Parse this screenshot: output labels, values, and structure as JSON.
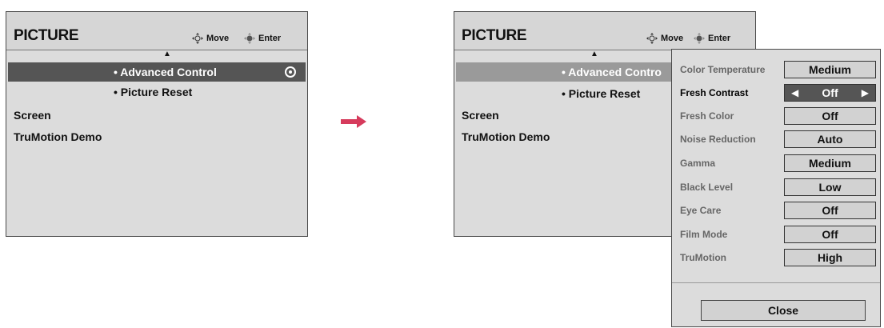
{
  "left_menu": {
    "title": "PICTURE",
    "nav_move": "Move",
    "nav_enter": "Enter",
    "up_arrow": "▲",
    "items": [
      {
        "label": "• Advanced Control",
        "selected": true
      },
      {
        "label": "• Picture Reset",
        "selected": false
      },
      {
        "label": "Screen",
        "selected": false
      },
      {
        "label": "TruMotion Demo",
        "selected": false
      }
    ]
  },
  "right_menu": {
    "title": "PICTURE",
    "nav_move": "Move",
    "nav_enter": "Enter",
    "up_arrow": "▲",
    "items": [
      {
        "label": "• Advanced Contro",
        "selected": true
      },
      {
        "label": "• Picture Reset",
        "selected": false
      },
      {
        "label": "Screen",
        "selected": false
      },
      {
        "label": "TruMotion Demo",
        "selected": false
      }
    ]
  },
  "advanced_control": {
    "options": [
      {
        "label": "Color Temperature",
        "value": "Medium",
        "active": false
      },
      {
        "label": "Fresh Contrast",
        "value": "Off",
        "active": true
      },
      {
        "label": "Fresh Color",
        "value": "Off",
        "active": false
      },
      {
        "label": "Noise Reduction",
        "value": "Auto",
        "active": false
      },
      {
        "label": "Gamma",
        "value": "Medium",
        "active": false
      },
      {
        "label": "Black Level",
        "value": "Low",
        "active": false
      },
      {
        "label": "Eye Care",
        "value": "Off",
        "active": false
      },
      {
        "label": "Film Mode",
        "value": "Off",
        "active": false
      },
      {
        "label": "TruMotion",
        "value": "High",
        "active": false
      }
    ],
    "left_arrow": "◀",
    "right_arrow": "▶",
    "close_label": "Close"
  },
  "colors": {
    "transition_arrow": "#d63b5c",
    "selection_dark": "#555555",
    "selection_light": "#9a9a9a",
    "panel_bg": "#dcdcdc"
  }
}
